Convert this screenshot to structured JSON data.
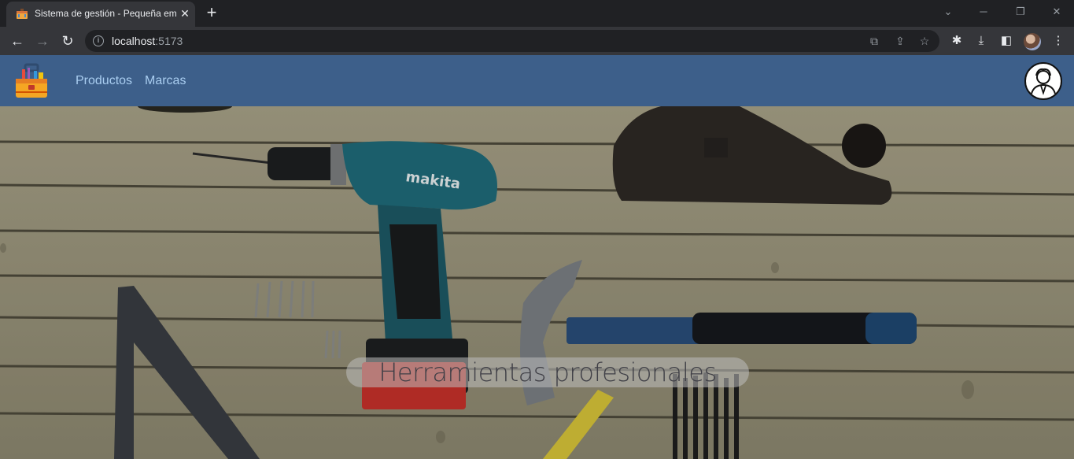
{
  "browser": {
    "tab_title": "Sistema de gestión - Pequeña em",
    "url_host": "localhost",
    "url_port": ":5173"
  },
  "app": {
    "nav_links": [
      "Productos",
      "Marcas"
    ]
  },
  "hero": {
    "caption": "Herramientas profesionales"
  }
}
